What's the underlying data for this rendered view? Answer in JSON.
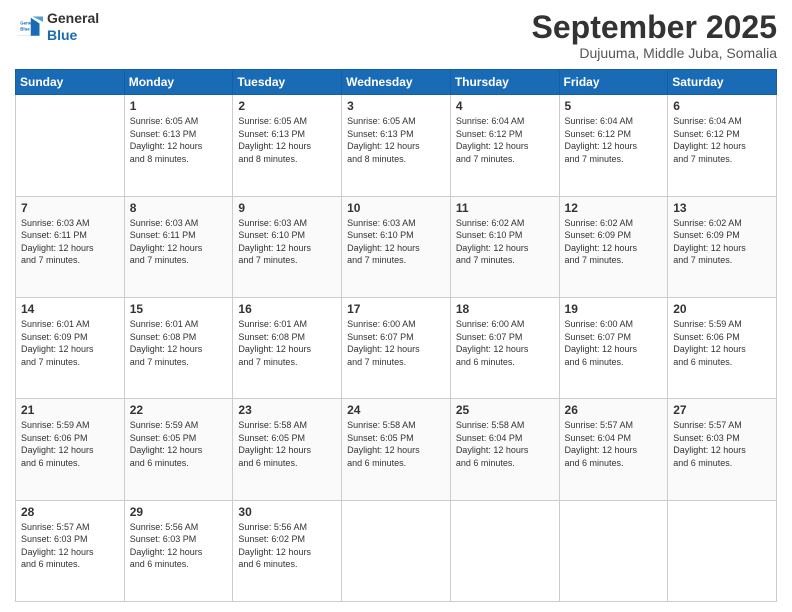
{
  "header": {
    "logo_line1": "General",
    "logo_line2": "Blue",
    "month_title": "September 2025",
    "subtitle": "Dujuuma, Middle Juba, Somalia"
  },
  "weekdays": [
    "Sunday",
    "Monday",
    "Tuesday",
    "Wednesday",
    "Thursday",
    "Friday",
    "Saturday"
  ],
  "weeks": [
    [
      {
        "day": "",
        "info": ""
      },
      {
        "day": "1",
        "info": "Sunrise: 6:05 AM\nSunset: 6:13 PM\nDaylight: 12 hours\nand 8 minutes."
      },
      {
        "day": "2",
        "info": "Sunrise: 6:05 AM\nSunset: 6:13 PM\nDaylight: 12 hours\nand 8 minutes."
      },
      {
        "day": "3",
        "info": "Sunrise: 6:05 AM\nSunset: 6:13 PM\nDaylight: 12 hours\nand 8 minutes."
      },
      {
        "day": "4",
        "info": "Sunrise: 6:04 AM\nSunset: 6:12 PM\nDaylight: 12 hours\nand 7 minutes."
      },
      {
        "day": "5",
        "info": "Sunrise: 6:04 AM\nSunset: 6:12 PM\nDaylight: 12 hours\nand 7 minutes."
      },
      {
        "day": "6",
        "info": "Sunrise: 6:04 AM\nSunset: 6:12 PM\nDaylight: 12 hours\nand 7 minutes."
      }
    ],
    [
      {
        "day": "7",
        "info": "Sunrise: 6:03 AM\nSunset: 6:11 PM\nDaylight: 12 hours\nand 7 minutes."
      },
      {
        "day": "8",
        "info": "Sunrise: 6:03 AM\nSunset: 6:11 PM\nDaylight: 12 hours\nand 7 minutes."
      },
      {
        "day": "9",
        "info": "Sunrise: 6:03 AM\nSunset: 6:10 PM\nDaylight: 12 hours\nand 7 minutes."
      },
      {
        "day": "10",
        "info": "Sunrise: 6:03 AM\nSunset: 6:10 PM\nDaylight: 12 hours\nand 7 minutes."
      },
      {
        "day": "11",
        "info": "Sunrise: 6:02 AM\nSunset: 6:10 PM\nDaylight: 12 hours\nand 7 minutes."
      },
      {
        "day": "12",
        "info": "Sunrise: 6:02 AM\nSunset: 6:09 PM\nDaylight: 12 hours\nand 7 minutes."
      },
      {
        "day": "13",
        "info": "Sunrise: 6:02 AM\nSunset: 6:09 PM\nDaylight: 12 hours\nand 7 minutes."
      }
    ],
    [
      {
        "day": "14",
        "info": "Sunrise: 6:01 AM\nSunset: 6:09 PM\nDaylight: 12 hours\nand 7 minutes."
      },
      {
        "day": "15",
        "info": "Sunrise: 6:01 AM\nSunset: 6:08 PM\nDaylight: 12 hours\nand 7 minutes."
      },
      {
        "day": "16",
        "info": "Sunrise: 6:01 AM\nSunset: 6:08 PM\nDaylight: 12 hours\nand 7 minutes."
      },
      {
        "day": "17",
        "info": "Sunrise: 6:00 AM\nSunset: 6:07 PM\nDaylight: 12 hours\nand 7 minutes."
      },
      {
        "day": "18",
        "info": "Sunrise: 6:00 AM\nSunset: 6:07 PM\nDaylight: 12 hours\nand 6 minutes."
      },
      {
        "day": "19",
        "info": "Sunrise: 6:00 AM\nSunset: 6:07 PM\nDaylight: 12 hours\nand 6 minutes."
      },
      {
        "day": "20",
        "info": "Sunrise: 5:59 AM\nSunset: 6:06 PM\nDaylight: 12 hours\nand 6 minutes."
      }
    ],
    [
      {
        "day": "21",
        "info": "Sunrise: 5:59 AM\nSunset: 6:06 PM\nDaylight: 12 hours\nand 6 minutes."
      },
      {
        "day": "22",
        "info": "Sunrise: 5:59 AM\nSunset: 6:05 PM\nDaylight: 12 hours\nand 6 minutes."
      },
      {
        "day": "23",
        "info": "Sunrise: 5:58 AM\nSunset: 6:05 PM\nDaylight: 12 hours\nand 6 minutes."
      },
      {
        "day": "24",
        "info": "Sunrise: 5:58 AM\nSunset: 6:05 PM\nDaylight: 12 hours\nand 6 minutes."
      },
      {
        "day": "25",
        "info": "Sunrise: 5:58 AM\nSunset: 6:04 PM\nDaylight: 12 hours\nand 6 minutes."
      },
      {
        "day": "26",
        "info": "Sunrise: 5:57 AM\nSunset: 6:04 PM\nDaylight: 12 hours\nand 6 minutes."
      },
      {
        "day": "27",
        "info": "Sunrise: 5:57 AM\nSunset: 6:03 PM\nDaylight: 12 hours\nand 6 minutes."
      }
    ],
    [
      {
        "day": "28",
        "info": "Sunrise: 5:57 AM\nSunset: 6:03 PM\nDaylight: 12 hours\nand 6 minutes."
      },
      {
        "day": "29",
        "info": "Sunrise: 5:56 AM\nSunset: 6:03 PM\nDaylight: 12 hours\nand 6 minutes."
      },
      {
        "day": "30",
        "info": "Sunrise: 5:56 AM\nSunset: 6:02 PM\nDaylight: 12 hours\nand 6 minutes."
      },
      {
        "day": "",
        "info": ""
      },
      {
        "day": "",
        "info": ""
      },
      {
        "day": "",
        "info": ""
      },
      {
        "day": "",
        "info": ""
      }
    ]
  ]
}
